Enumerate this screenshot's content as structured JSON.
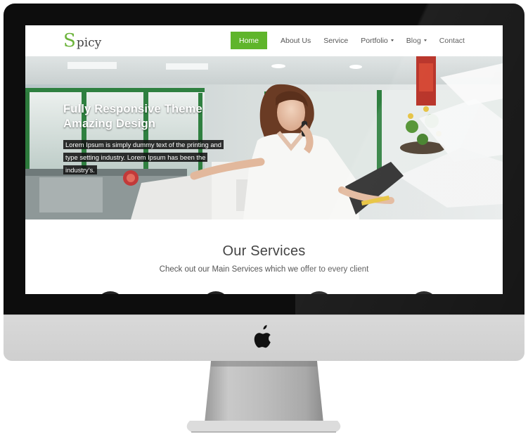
{
  "site": {
    "brand_initial": "S",
    "brand_rest": "picy",
    "accent_color": "#5fb52b"
  },
  "nav": {
    "items": [
      {
        "label": "Home",
        "active": true
      },
      {
        "label": "About Us"
      },
      {
        "label": "Service"
      },
      {
        "label": "Portfolio",
        "dropdown": true
      },
      {
        "label": "Blog",
        "dropdown": true
      },
      {
        "label": "Contact"
      }
    ]
  },
  "hero": {
    "title_line1": "Fully Responsive Theme",
    "title_line2": "Amazing Design",
    "description": "Lorem Ipsum is simply dummy text of the printing and type setting industry. Lorem Ipsum has been the industry's."
  },
  "services": {
    "title": "Our Services",
    "subtitle": "Check out our Main Services which we offer to every client"
  },
  "device": {
    "logo_icon": "apple-icon"
  }
}
